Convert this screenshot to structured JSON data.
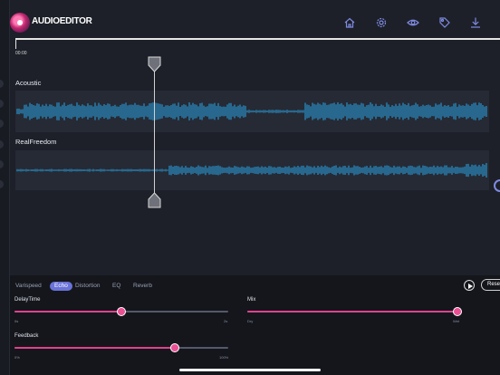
{
  "app": {
    "brand": "AUDIOEDITOR"
  },
  "nav": [
    {
      "icon": "home-icon"
    },
    {
      "icon": "gear-icon"
    },
    {
      "icon": "eye-icon"
    },
    {
      "icon": "tag-icon"
    },
    {
      "icon": "download-icon"
    }
  ],
  "timeline": {
    "start_time": "00:00"
  },
  "tracks": [
    {
      "name": "Acoustic"
    },
    {
      "name": "RealFreedom"
    }
  ],
  "colors": {
    "accent": "#6a73d8",
    "slider": "#e0428c",
    "wave": "#2aa6e8"
  },
  "effects": {
    "tabs": [
      "Varispeed",
      "Echo",
      "Distortion",
      "EQ",
      "Reverb"
    ],
    "active_tab": "Echo",
    "reset_label": "Reset",
    "sliders": {
      "delay": {
        "label": "DelayTime",
        "min": "0s",
        "max": "2s",
        "value": 0.5
      },
      "mix": {
        "label": "Mix",
        "min": "Dry",
        "max": "Wet",
        "value": 1.0
      },
      "feedback": {
        "label": "Feedback",
        "min": "0%",
        "max": "100%",
        "value": 0.75
      }
    }
  }
}
